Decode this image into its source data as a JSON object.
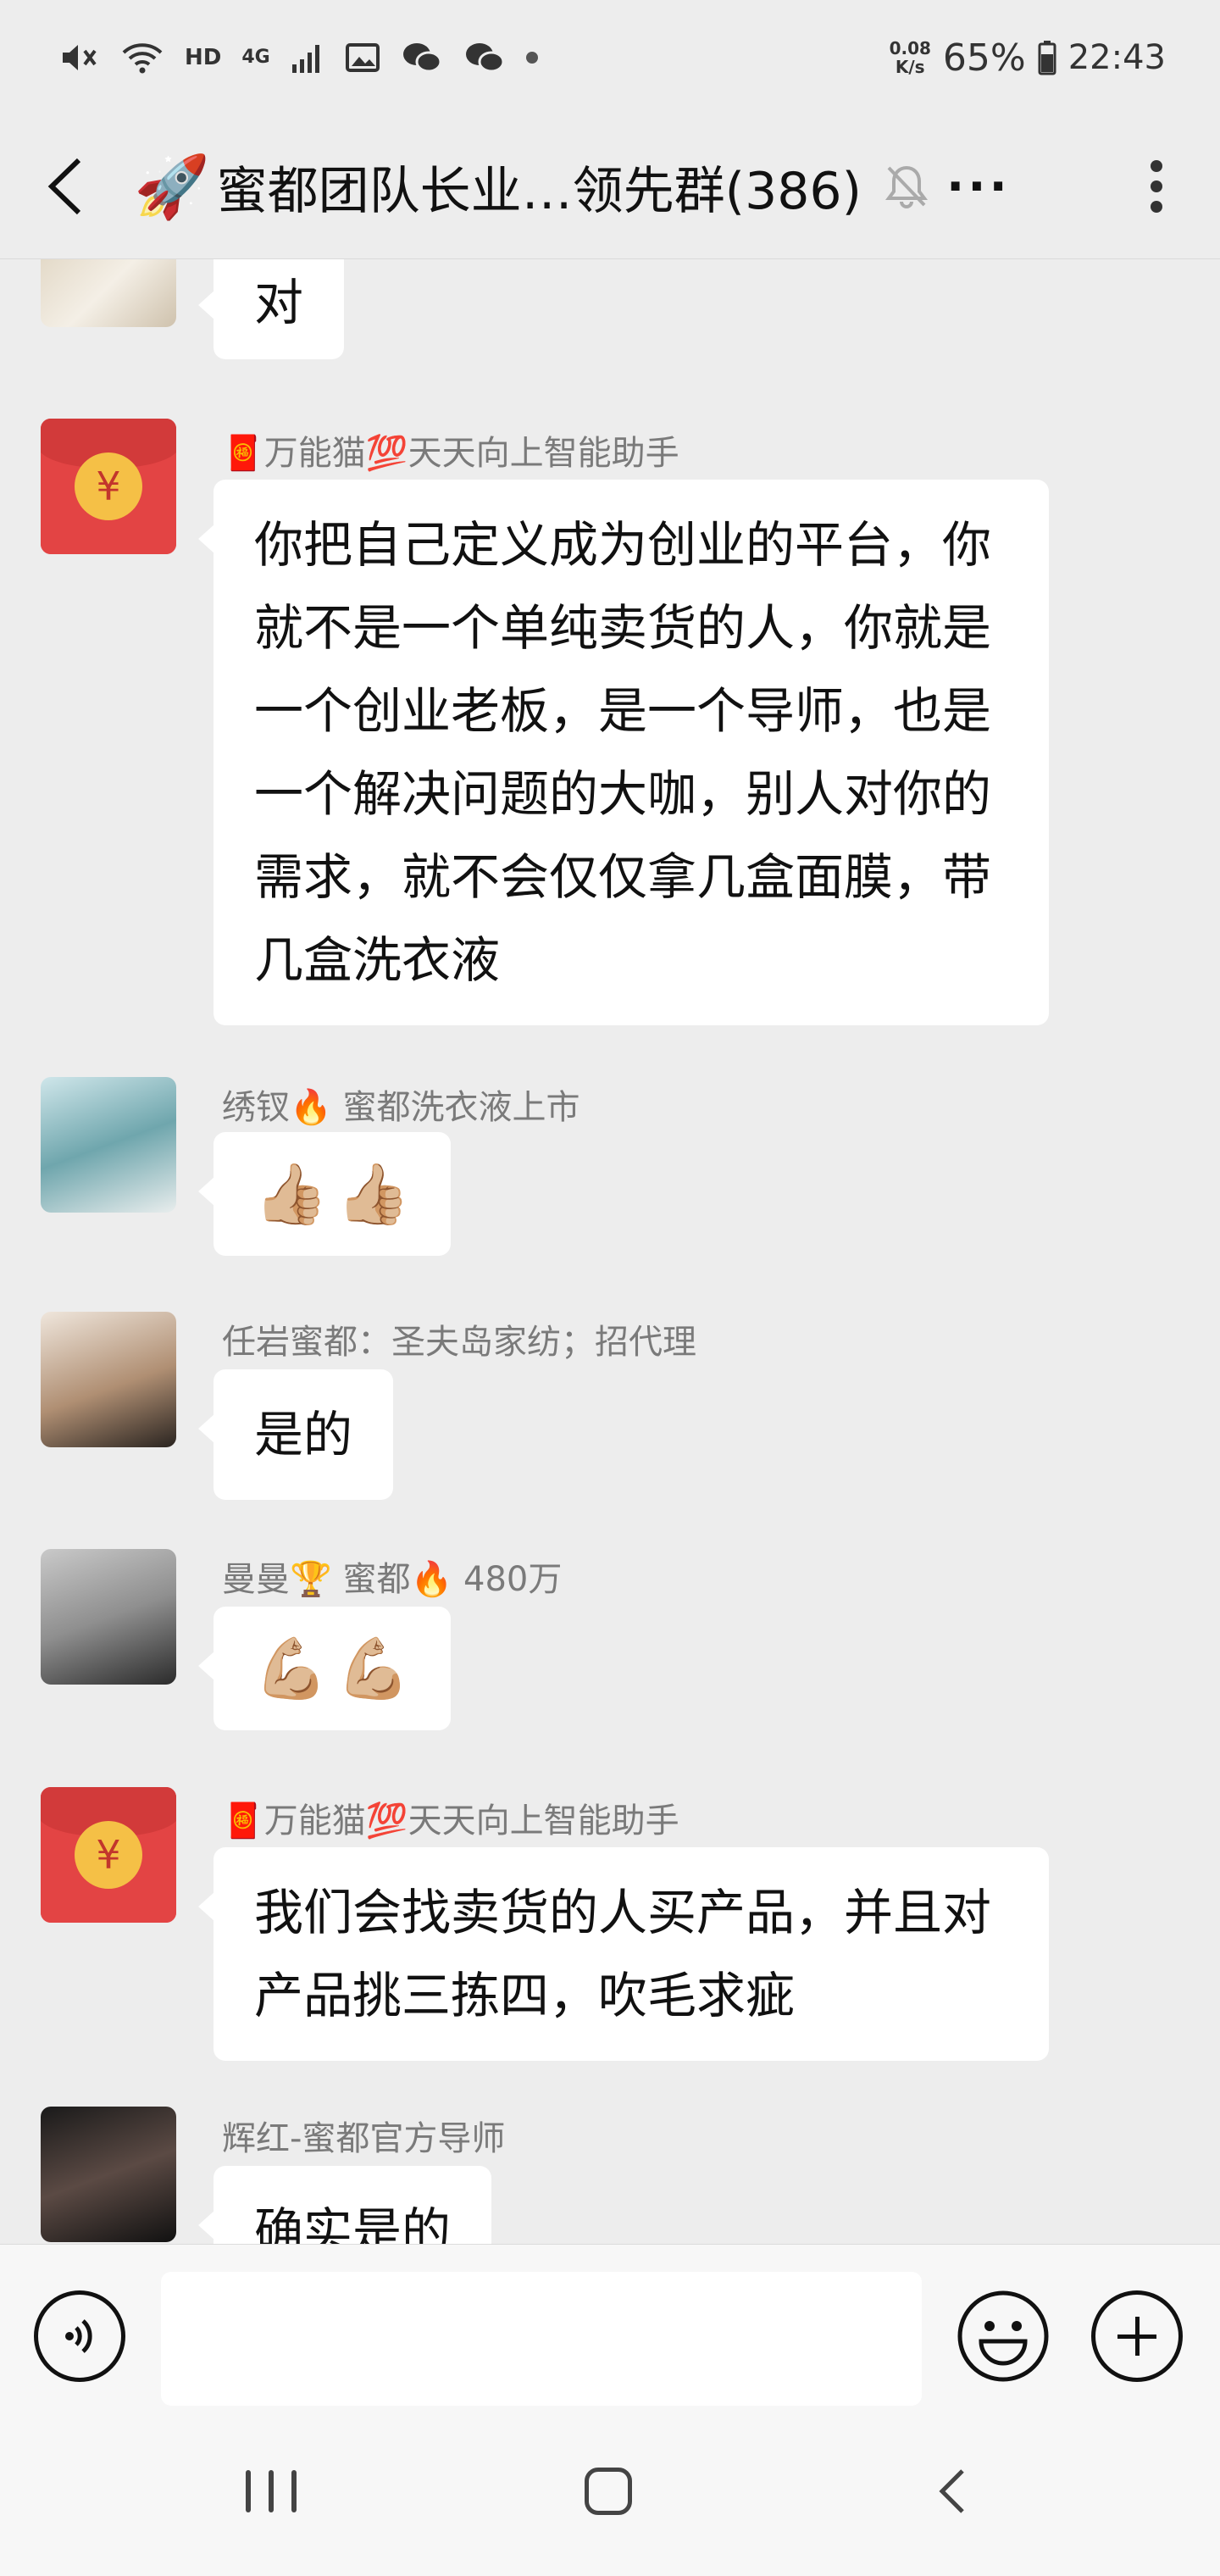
{
  "status_bar": {
    "hd": "HD",
    "network": "4G",
    "speed_value": "0.08",
    "speed_unit": "K/s",
    "battery": "65%",
    "time": "22:43"
  },
  "header": {
    "title": "蜜都团队长业…领先群(386)",
    "title_emoji": "🚀",
    "more": "···"
  },
  "messages": [
    {
      "sender": "",
      "text": "对"
    },
    {
      "sender": "🧧万能猫💯天天向上智能助手",
      "text": "你把自己定义成为创业的平台，你就不是一个单纯卖货的人，你就是一个创业老板，是一个导师，也是一个解决问题的大咖，别人对你的需求，就不会仅仅拿几盒面膜，带几盒洗衣液"
    },
    {
      "sender": "绣钗🔥 蜜都洗衣液上市",
      "emoji": [
        "👍🏼",
        "👍🏼"
      ]
    },
    {
      "sender": "任岩蜜都：圣夫岛家纺；招代理",
      "text": "是的"
    },
    {
      "sender": "曼曼🏆 蜜都🔥 480万",
      "emoji": [
        "💪🏼",
        "💪🏼"
      ]
    },
    {
      "sender": "🧧万能猫💯天天向上智能助手",
      "text": "我们会找卖货的人买产品，并且对产品挑三拣四，吹毛求疵"
    },
    {
      "sender": "辉红-蜜都官方导师",
      "text": "确实是的"
    }
  ],
  "colors": {
    "background": "#ededed",
    "bubble": "#ffffff",
    "red_packet": "#e34444",
    "coin": "#f5c046"
  }
}
